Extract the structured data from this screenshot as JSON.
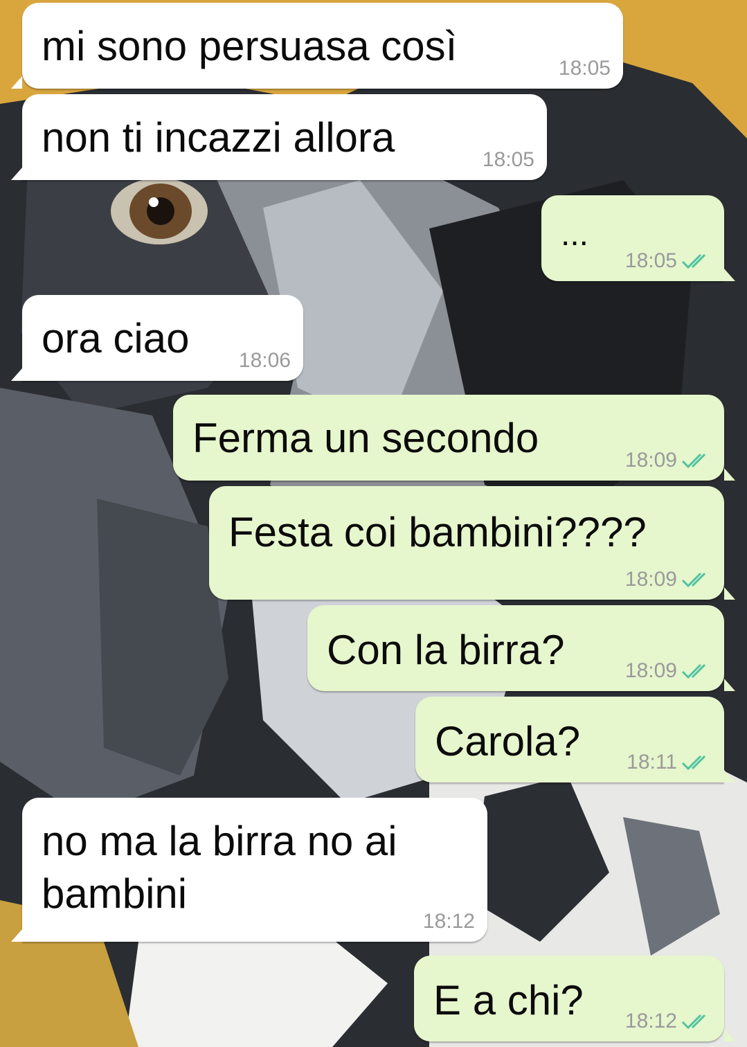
{
  "colors": {
    "incoming_bubble": "#ffffff",
    "outgoing_bubble": "#e6f6cd",
    "timestamp": "#9a9a9a",
    "read_ticks": "#4fc3a1",
    "wallpaper_yellow": "#d9a63e"
  },
  "wallpaper": {
    "description": "dog-painting-wallpaper"
  },
  "messages": [
    {
      "direction": "incoming",
      "text": "mi sono persuasa così",
      "time": "18:05"
    },
    {
      "direction": "incoming",
      "text": "non ti incazzi allora",
      "time": "18:05"
    },
    {
      "direction": "outgoing",
      "text": "...",
      "time": "18:05",
      "status_icon": "double-check-icon"
    },
    {
      "direction": "incoming",
      "text": "ora ciao",
      "time": "18:06"
    },
    {
      "direction": "outgoing",
      "text": "Ferma un secondo",
      "time": "18:09",
      "status_icon": "double-check-icon"
    },
    {
      "direction": "outgoing",
      "text": "Festa coi bambini????",
      "time": "18:09",
      "status_icon": "double-check-icon"
    },
    {
      "direction": "outgoing",
      "text": "Con la birra?",
      "time": "18:09",
      "status_icon": "double-check-icon"
    },
    {
      "direction": "outgoing",
      "text": "Carola?",
      "time": "18:11",
      "status_icon": "double-check-icon"
    },
    {
      "direction": "incoming",
      "text_lines": [
        "no ma la birra no ai",
        "bambini"
      ],
      "time": "18:12"
    },
    {
      "direction": "outgoing",
      "text": "E a chi?",
      "time": "18:12",
      "status_icon": "double-check-icon"
    }
  ]
}
